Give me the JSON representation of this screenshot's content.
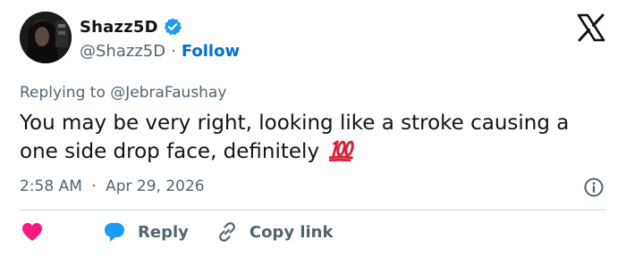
{
  "author": {
    "display_name": "Shazz5D",
    "handle": "@Shazz5D",
    "separator": "·",
    "follow_label": "Follow"
  },
  "reply_context": "Replying to @JebraFaushay",
  "tweet": {
    "text": "You may be very right, looking like a stroke causing a one side drop face, definitely",
    "emoji": "hundred-points-emoji"
  },
  "meta": {
    "time": "2:58 AM",
    "separator": "·",
    "date": "Apr 29, 2026"
  },
  "actions": {
    "reply_label": "Reply",
    "copy_link_label": "Copy link"
  },
  "icons": {
    "verified": "verified-badge-icon",
    "logo": "x-logo-icon",
    "info": "info-icon",
    "like": "heart-icon",
    "reply": "reply-bubble-icon",
    "link": "link-icon"
  },
  "colors": {
    "accent": "#1d9bf0",
    "follow": "#006fd6",
    "like": "#f91880",
    "secondary_text": "#536471",
    "primary_text": "#0f1419",
    "divider": "#cfd9de"
  }
}
